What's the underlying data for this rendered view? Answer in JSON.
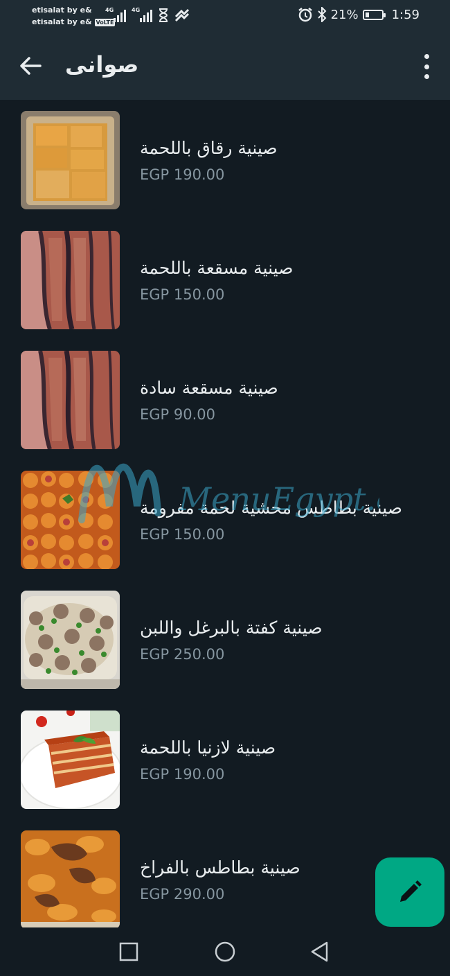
{
  "status_bar": {
    "carrier1": "etisalat by e&",
    "carrier2": "etisalat by e&",
    "volte": "VoLTE",
    "network1": "4G",
    "network2": "4G",
    "battery": "21%",
    "battery_level": 0.21,
    "time": "1:59"
  },
  "header": {
    "title": "صوانى"
  },
  "items": [
    {
      "name": "صينية رقاق باللحمة",
      "price": "EGP 190.00"
    },
    {
      "name": "صينية مسقعة باللحمة",
      "price": "EGP 150.00"
    },
    {
      "name": "صينية مسقعة سادة",
      "price": "EGP 90.00"
    },
    {
      "name": "صينية بطاطس محشية لحمة مفرومة",
      "price": "EGP 150.00"
    },
    {
      "name": "صينية كفتة بالبرغل واللبن",
      "price": "EGP 250.00"
    },
    {
      "name": "صينية لازنيا باللحمة",
      "price": "EGP 190.00"
    },
    {
      "name": "صينية بطاطس بالفراخ",
      "price": "EGP 290.00"
    }
  ],
  "watermark": "MenuEgypt.com",
  "colors": {
    "background": "#121b22",
    "bar": "#1f2c34",
    "fab": "#00a884",
    "price": "#8696a0"
  },
  "icons": {
    "back": "arrow-left-icon",
    "menu": "more-vert-icon",
    "fab": "pencil-icon"
  }
}
